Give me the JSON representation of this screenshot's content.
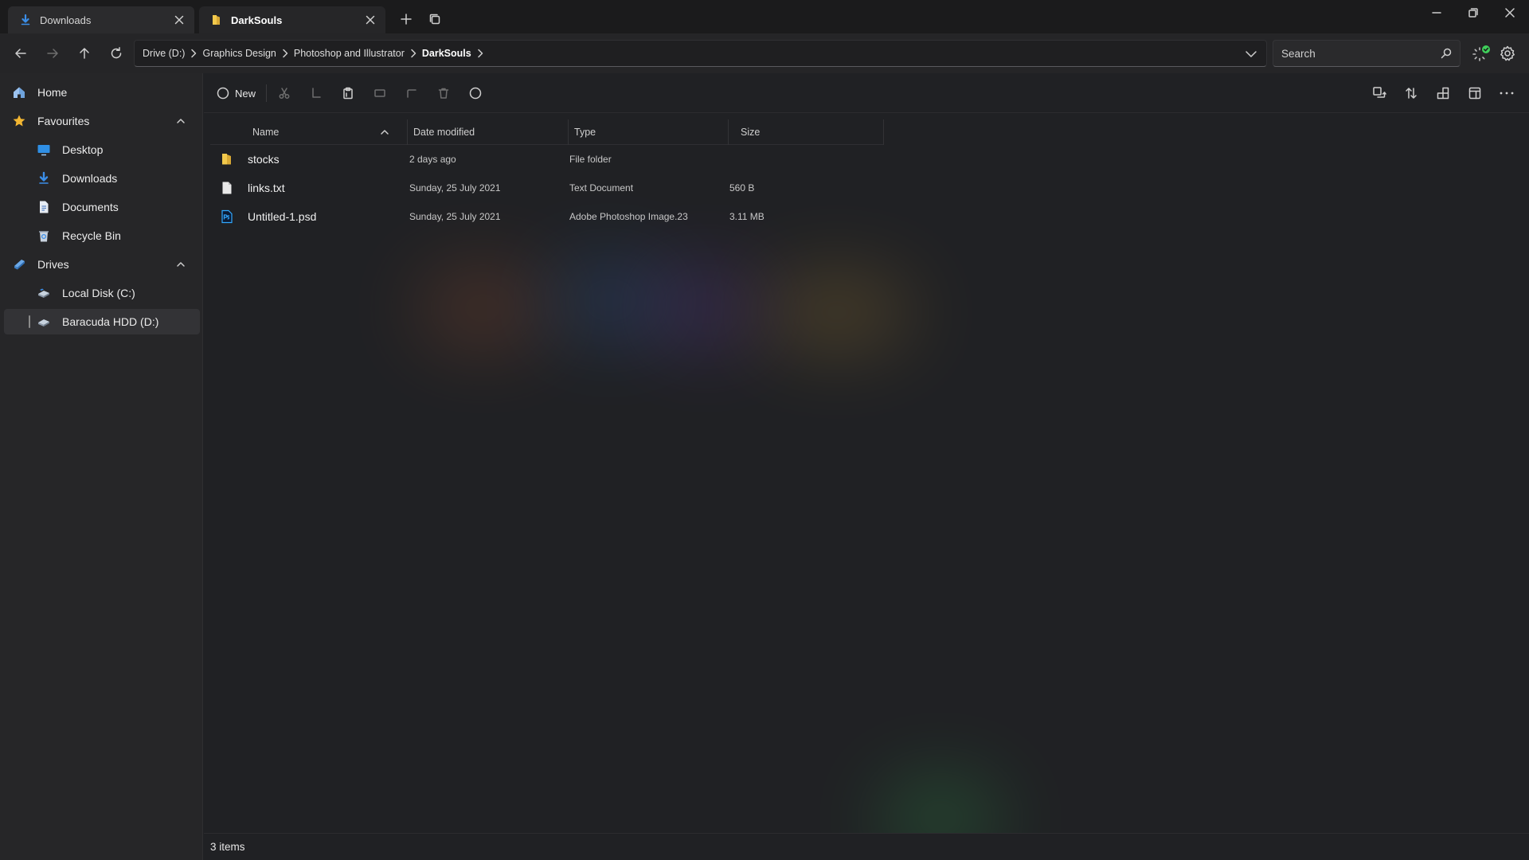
{
  "tabs": [
    {
      "label": "Downloads",
      "icon": "download-icon",
      "active": false
    },
    {
      "label": "DarkSouls",
      "icon": "folder-icon",
      "active": true
    }
  ],
  "address": {
    "crumbs": [
      "Drive (D:)",
      "Graphics Design",
      "Photoshop and Illustrator",
      "DarkSouls"
    ]
  },
  "search": {
    "placeholder": "Search"
  },
  "sidebar": {
    "home": "Home",
    "favourites": {
      "label": "Favourites",
      "items": [
        "Desktop",
        "Downloads",
        "Documents",
        "Recycle Bin"
      ]
    },
    "drives": {
      "label": "Drives",
      "items": [
        "Local Disk (C:)",
        "Baracuda HDD (D:)"
      ]
    }
  },
  "toolbar": {
    "new_label": "New"
  },
  "columns": {
    "name": "Name",
    "date": "Date modified",
    "type": "Type",
    "size": "Size"
  },
  "files": [
    {
      "name": "stocks",
      "date": "2 days ago",
      "type": "File folder",
      "size": "",
      "icon": "folder-icon"
    },
    {
      "name": "links.txt",
      "date": "Sunday, 25 July 2021",
      "type": "Text Document",
      "size": "560 B",
      "icon": "text-file-icon"
    },
    {
      "name": "Untitled-1.psd",
      "date": "Sunday, 25 July 2021",
      "type": "Adobe Photoshop Image.23",
      "size": "3.11 MB",
      "icon": "photoshop-file-icon"
    }
  ],
  "status": {
    "item_count": "3 items"
  },
  "colors": {
    "folder": "#f2c94c",
    "accent": "#3b8ee8",
    "sync_ok": "#3fcf5a",
    "background": "#202124"
  }
}
